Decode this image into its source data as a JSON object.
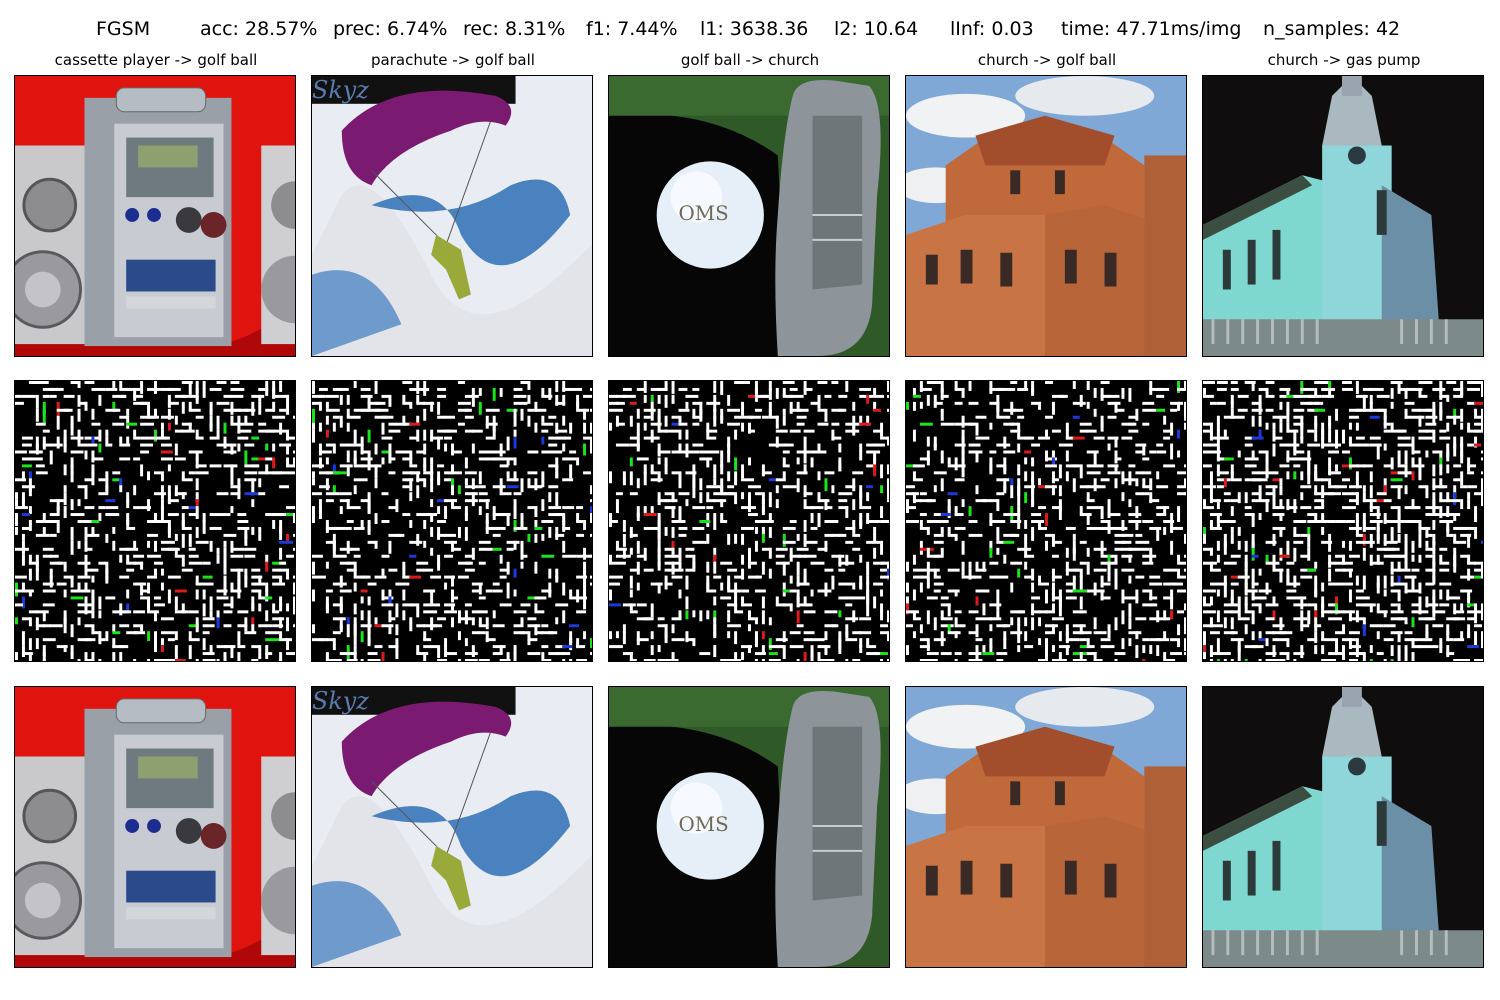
{
  "header": {
    "method": "FGSM",
    "acc": "acc: 28.57%",
    "prec": "prec: 6.74%",
    "rec": "rec: 8.31%",
    "f1": "f1: 7.44%",
    "l1": "l1: 3638.36",
    "l2": "l2: 10.64",
    "linf": "lInf: 0.03",
    "time": "time: 47.71ms/img",
    "n_samples": "n_samples: 42"
  },
  "columns": [
    {
      "title": "cassette player -> golf ball",
      "image": "cassette-player-stereo"
    },
    {
      "title": "parachute -> golf ball",
      "image": "parachute-sky"
    },
    {
      "title": "golf ball -> church",
      "image": "golf-ball-putter",
      "ball_text": "OMS"
    },
    {
      "title": "church -> golf ball",
      "image": "brick-church"
    },
    {
      "title": "church -> gas pump",
      "image": "white-church-night"
    }
  ],
  "parachute_watermark": "Skyz",
  "rows": [
    "original-image",
    "perturbation-map",
    "adversarial-image"
  ]
}
